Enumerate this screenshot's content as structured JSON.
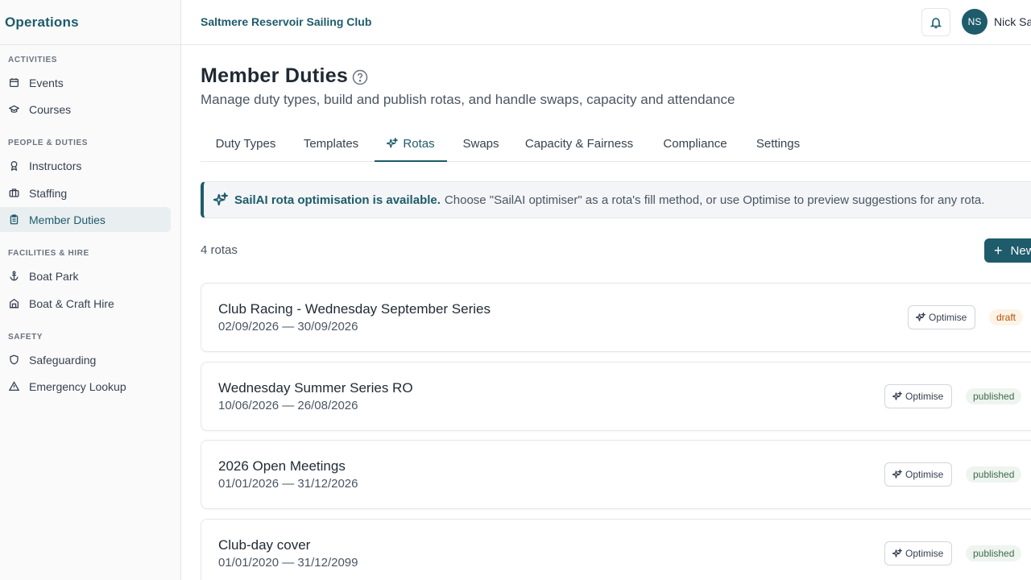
{
  "sidebar": {
    "title": "Operations",
    "sections": [
      {
        "title": "ACTIVITIES",
        "items": [
          {
            "label": "Events",
            "icon": "calendar-icon"
          },
          {
            "label": "Courses",
            "icon": "graduation-cap-icon"
          }
        ]
      },
      {
        "title": "PEOPLE & DUTIES",
        "items": [
          {
            "label": "Instructors",
            "icon": "award-icon"
          },
          {
            "label": "Staffing",
            "icon": "briefcase-icon"
          },
          {
            "label": "Member Duties",
            "icon": "clipboard-icon",
            "active": true
          }
        ]
      },
      {
        "title": "FACILITIES & HIRE",
        "items": [
          {
            "label": "Boat Park",
            "icon": "anchor-icon"
          },
          {
            "label": "Boat & Craft Hire",
            "icon": "building-icon"
          }
        ]
      },
      {
        "title": "SAFETY",
        "items": [
          {
            "label": "Safeguarding",
            "icon": "shield-icon"
          },
          {
            "label": "Emergency Lookup",
            "icon": "alert-triangle-icon"
          }
        ]
      }
    ]
  },
  "topbar": {
    "club_name": "Saltmere Reservoir Sailing Club",
    "avatar_initials": "NS",
    "user_name": "Nick Sa"
  },
  "page": {
    "title": "Member Duties",
    "subtitle": "Manage duty types, build and publish rotas, and handle swaps, capacity and attendance"
  },
  "tabs": [
    {
      "label": "Duty Types"
    },
    {
      "label": "Templates"
    },
    {
      "label": "Rotas",
      "active": true,
      "icon": "sparkles-icon"
    },
    {
      "label": "Swaps"
    },
    {
      "label": "Capacity & Fairness"
    },
    {
      "label": "Compliance"
    },
    {
      "label": "Settings"
    }
  ],
  "banner": {
    "strong": "SailAI rota optimisation is available.",
    "text": "Choose \"SailAI optimiser\" as a rota's fill method, or use Optimise to preview suggestions for any rota."
  },
  "rotas_count": "4 rotas",
  "new_button_label": "New",
  "rotas": [
    {
      "name": "Club Racing - Wednesday September Series",
      "dates": "02/09/2026 — 30/09/2026",
      "optimise_label": "Optimise",
      "status": "draft"
    },
    {
      "name": "Wednesday Summer Series RO",
      "dates": "10/06/2026 — 26/08/2026",
      "optimise_label": "Optimise",
      "status": "published"
    },
    {
      "name": "2026 Open Meetings",
      "dates": "01/01/2026 — 31/12/2026",
      "optimise_label": "Optimise",
      "status": "published"
    },
    {
      "name": "Club-day cover",
      "dates": "01/01/2020 — 31/12/2099",
      "optimise_label": "Optimise",
      "status": "published"
    }
  ],
  "colors": {
    "brand": "#1e5b6b",
    "draft": "#b45309",
    "published": "#3f6b4a"
  }
}
